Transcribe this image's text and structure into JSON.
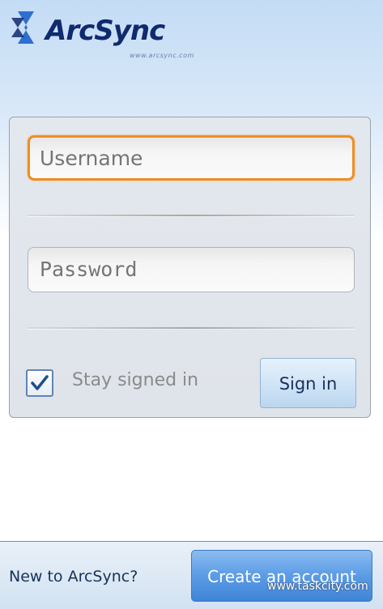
{
  "brand": {
    "name": "ArcSync",
    "url": "www.arcsync.com",
    "mark_icon": "double-chevron-logo-mark",
    "colors": {
      "primary": "#0f2a6e",
      "accent": "#2f6fd0"
    }
  },
  "login": {
    "username_placeholder": "Username",
    "password_placeholder": "Password",
    "username_value": "",
    "password_value": "",
    "stay_signed_in_label": "Stay signed in",
    "stay_signed_in_checked": true,
    "sign_in_label": "Sign in",
    "focus_color": "#ec8f26"
  },
  "footer": {
    "prompt": "New to ArcSync?",
    "create_account_label": "Create an account",
    "button_color": "#3f84d8"
  },
  "watermark": "www.taskcity.com"
}
